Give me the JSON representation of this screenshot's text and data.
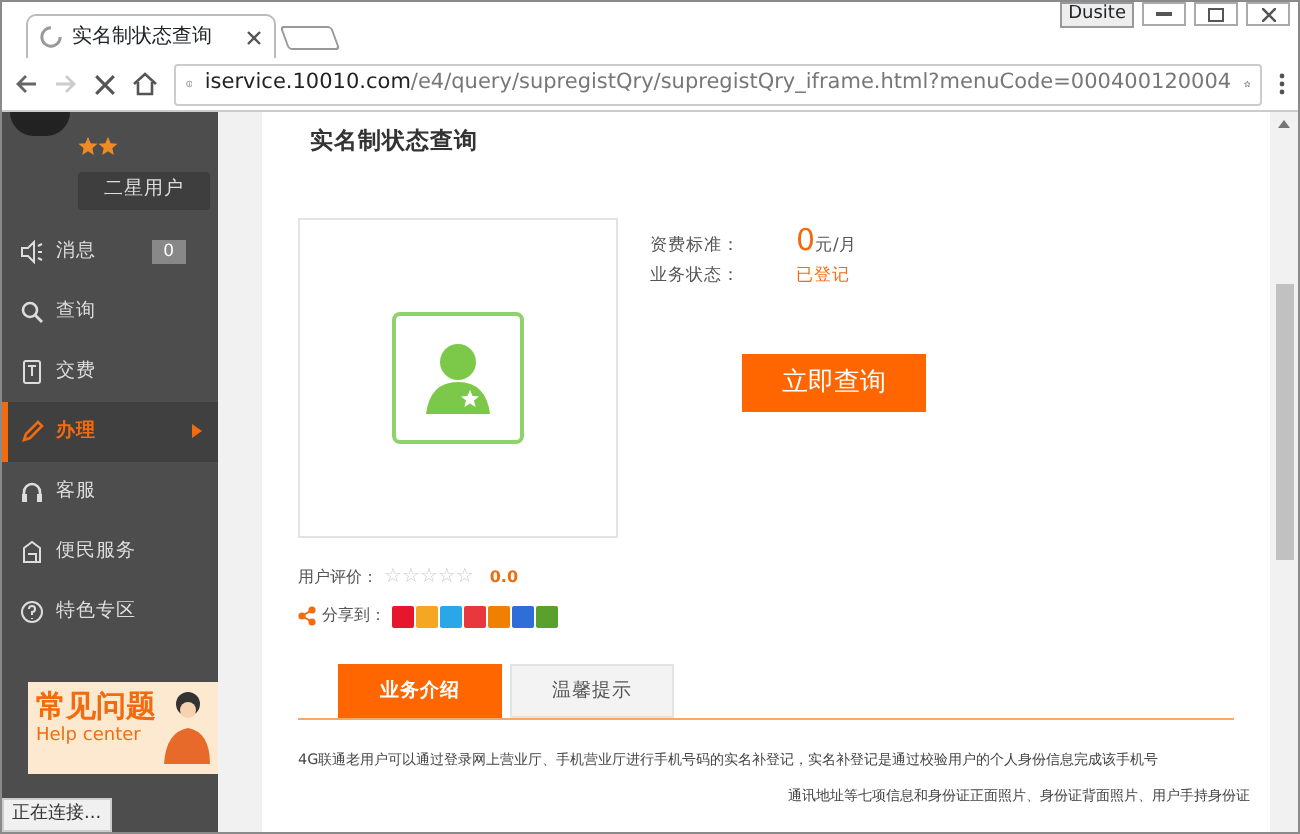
{
  "browser": {
    "tab_title": "实名制状态查询",
    "extension_label": "Dusite",
    "url_host": "iservice.10010.com",
    "url_path": "/e4/query/supregistQry/supregistQry_iframe.html?menuCode=000400120004",
    "loading": true
  },
  "sidebar": {
    "user_level": "二星用户",
    "items": [
      {
        "label": "消息",
        "badge": "0",
        "selected": false
      },
      {
        "label": "查询",
        "selected": false
      },
      {
        "label": "交费",
        "selected": false
      },
      {
        "label": "办理",
        "selected": true
      },
      {
        "label": "客服",
        "selected": false
      },
      {
        "label": "便民服务",
        "selected": false
      },
      {
        "label": "特色专区",
        "selected": false
      }
    ],
    "banner": {
      "title": "常见问题",
      "subtitle": "Help center"
    }
  },
  "main": {
    "title": "实名制状态查询",
    "fee_label": "资费标准：",
    "fee_value": "0",
    "fee_unit": "元/月",
    "status_label": "业务状态：",
    "status_value": "已登记",
    "query_button": "立即查询",
    "rating_label": "用户评价：",
    "stars": 0,
    "rating_value": "0.0",
    "share_label": "分享到：",
    "share_icons": [
      {
        "color": "#e6162d"
      },
      {
        "color": "#f5a623"
      },
      {
        "color": "#2aa7e6"
      },
      {
        "color": "#e8383d"
      },
      {
        "color": "#f08000"
      },
      {
        "color": "#2f6ed8"
      },
      {
        "color": "#5aa02c"
      }
    ],
    "tabs": [
      {
        "label": "业务介绍",
        "selected": true
      },
      {
        "label": "温馨提示",
        "selected": false
      }
    ],
    "intro_lines": [
      "4G联通老用户可以通过登录网上营业厅、手机营业厅进行手机号码的实名补登记，实名补登记是通过校验用户的个人身份信息完成该手机号",
      "通讯地址等七项信息和身份证正面照片、身份证背面照片、用户手持身份证"
    ]
  },
  "status_bar": "正在连接..."
}
